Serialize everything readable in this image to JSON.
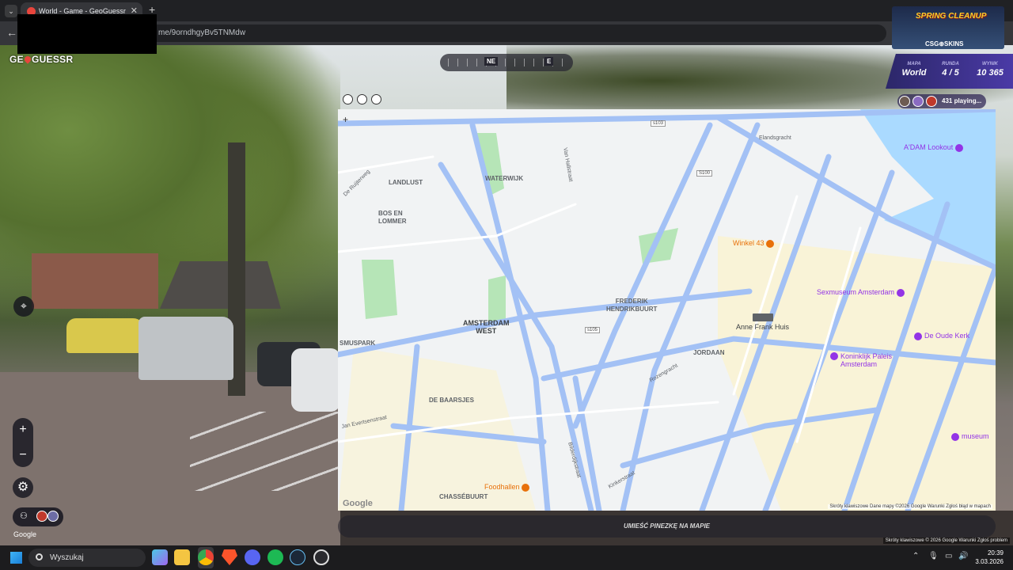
{
  "browser": {
    "tab_title": "World - Game - GeoGuessr",
    "tab_close": "✕",
    "new_tab": "+",
    "tab_menu": "⌄",
    "back": "←",
    "url_visible": "me/9orndhgyBv5TNMdw"
  },
  "game": {
    "logo_before": "GE",
    "logo_after": "GUESSR",
    "compass": {
      "ne": "NE",
      "e": "E"
    },
    "stats": {
      "map_label": "MAPA",
      "map_value": "World",
      "round_label": "RUNDA",
      "round_value": "4 / 5",
      "score_label": "WYNIK",
      "score_value": "10 365"
    },
    "playing": "431 playing...",
    "banner_top": "SPRING CLEANUP",
    "banner_bottom": "CSG⊕SKINS",
    "place_pin": "UMIEŚĆ PINEZKĘ NA MAPIE",
    "zoom_in": "+",
    "zoom_out": "−",
    "settings_icon": "⚙",
    "pin_icon": "⌖",
    "google_sv": "Google",
    "sv_footer": "Skróty klawiszowe   © 2026 Google   Warunki   Zgłoś problem"
  },
  "map": {
    "zoom_plus": "+",
    "google": "Google",
    "footer": "Skróty klawiszowe   Dane mapy ©2026 Google   Warunki   Zgłoś błąd w mapach",
    "districts": {
      "landlust": "LANDLUST",
      "waterwijk": "WATERWIJK",
      "bos_en_lommer": "BOS EN\nLOMMER",
      "frederik": "FREDERIK\nHENDRIKBUURT",
      "amsterdam_west": "AMSTERDAM\nWEST",
      "jordaan": "JORDAAN",
      "de_baarsjes": "DE BAARSJES",
      "chassebuurt": "CHASSÉBUURT",
      "smuspark": "SMUSPARK"
    },
    "streets": {
      "van_hallstraat": "Van Hallstraat",
      "rozengracht": "Rozengracht",
      "jan_evertsen": "Jan Evertsenstraat",
      "kinkerstraat": "Kinkerstraat",
      "bilderdijkstraat": "Bilderdijkstraat",
      "de_ruijterweg": "De Ruijterweg",
      "elandsgracht": "Elandsgracht"
    },
    "shields": {
      "s100": "S100",
      "s103": "s103",
      "s105": "s105"
    },
    "pois": {
      "adam": "A'DAM Lookout",
      "winkel": "Winkel 43",
      "sexmuseum": "Sexmuseum Amsterdam",
      "anne_frank": "Anne Frank Huis",
      "oude_kerk": "De Oude Kerk",
      "paleis": "Koninklijk Paleis\nAmsterdam",
      "museum": "museum",
      "foodhallen": "Foodhallen"
    },
    "colors": {
      "road": "#a3c1f5",
      "water": "#aadaff",
      "park": "#b6e5b7",
      "bg": "#f1f3f4",
      "poi_orange": "#e8710a",
      "poi_purple": "#9334e6"
    }
  },
  "taskbar": {
    "search": "Wyszukaj",
    "time": "20:39",
    "date": "3.03.2026"
  }
}
